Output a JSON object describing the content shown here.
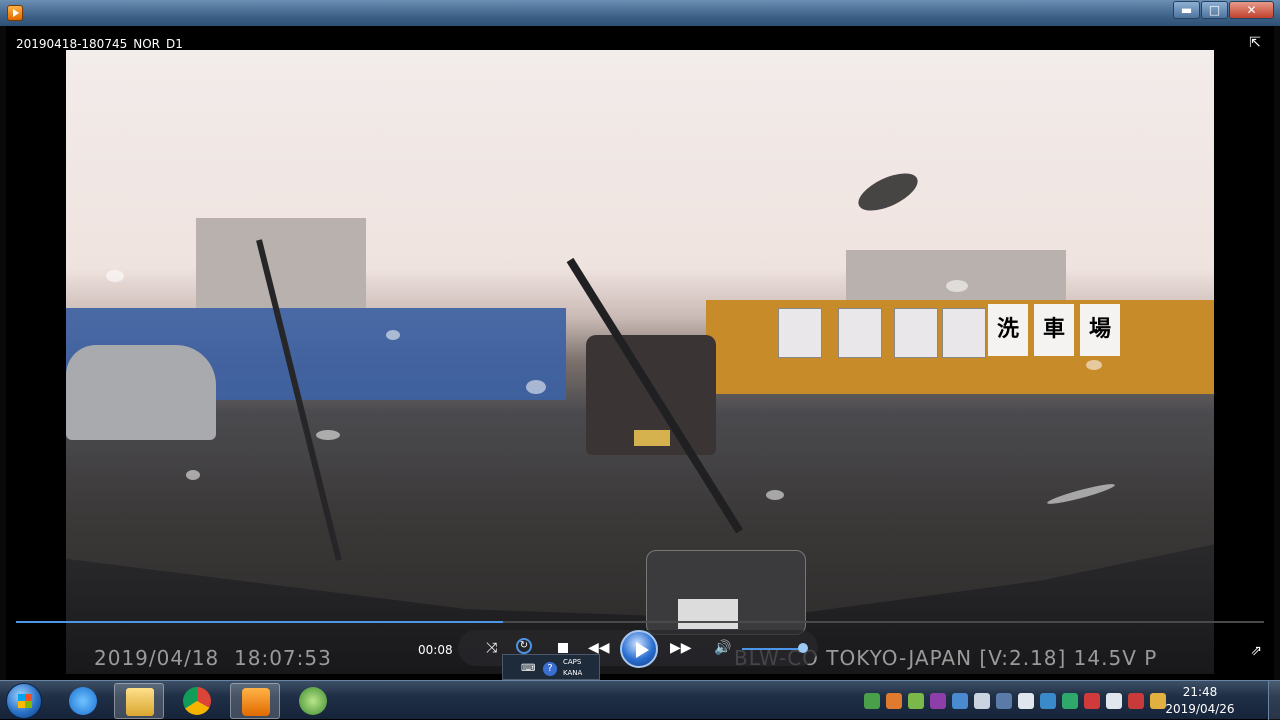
{
  "window": {
    "minimize_label": "▬",
    "maximize_label": "□",
    "close_label": "✕"
  },
  "player": {
    "file_title": "20190418-180745_NOR_D1",
    "fullscreen_icon": "collapse-arrows-icon",
    "elapsed": "00:08",
    "progress_fraction": 0.39,
    "volume_fraction": 0.9,
    "overlay_date": "2019/04/18",
    "overlay_time": "18:07:53",
    "overlay_info": "BLW-CO  TOKYO-JAPAN  [V:2.18]  14.5V  P"
  },
  "video_scene": {
    "sign_chars": [
      "洗",
      "車",
      "場"
    ]
  },
  "controls": {
    "shuffle_icon": "shuffle-icon",
    "repeat_icon": "repeat-icon",
    "stop_icon": "stop-icon",
    "prev_icon": "rewind-icon",
    "play_icon": "play-icon",
    "next_icon": "fast-forward-icon",
    "volume_icon": "volume-icon"
  },
  "ime": {
    "caps": "CAPS",
    "kana": "KANA"
  },
  "taskbar": {
    "apps": [
      {
        "name": "internet-explorer",
        "active": false
      },
      {
        "name": "file-explorer",
        "active": true
      },
      {
        "name": "chrome",
        "active": false
      },
      {
        "name": "media-player",
        "active": true
      },
      {
        "name": "green-app",
        "active": false
      }
    ],
    "clock_time": "21:48",
    "clock_date": "2019/04/26"
  },
  "colors": {
    "accent": "#4d95e6",
    "title_bar": "#3f6389"
  }
}
